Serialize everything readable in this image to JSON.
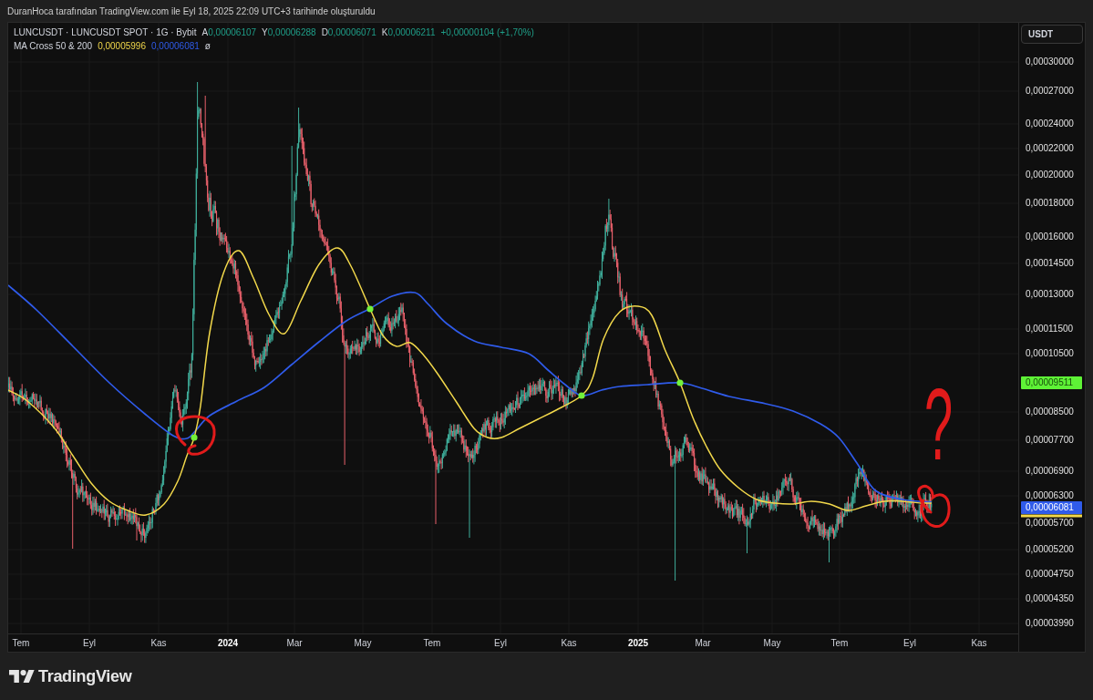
{
  "header": {
    "title": "DuranHoca tarafından TradingView.com ile Eyl 18, 2025 22:09 UTC+3 tarihinde oluşturuldu"
  },
  "legend": {
    "symbol": "LUNCUSDT · LUNCUSDT SPOT · 1G · Bybit",
    "ohlc": [
      {
        "letter": "A",
        "value": "0,00006107"
      },
      {
        "letter": "Y",
        "value": "0,00006288"
      },
      {
        "letter": "D",
        "value": "0,00006071"
      },
      {
        "letter": "K",
        "value": "0,00006211"
      }
    ],
    "change": "+0,00000104 (+1,70%)",
    "indicator": {
      "name": "MA Cross 50 & 200",
      "values": [
        {
          "text": "0,00005996",
          "color": "#f2d84b"
        },
        {
          "text": "0,00006081",
          "color": "#2f5bea"
        }
      ],
      "symbol": "ø"
    }
  },
  "price_axis": {
    "currency": "USDT",
    "labels": [
      "0,00030000",
      "0,00027000",
      "0,00024000",
      "0,00022000",
      "0,00020000",
      "0,00018000",
      "0,00016000",
      "0,00014500",
      "0,00013000",
      "0,00011500",
      "0,00010500",
      "0,00008500",
      "0,00007700",
      "0,00006900",
      "0,00006300",
      "0,00005700",
      "0,00005200",
      "0,00004750",
      "0,00004350",
      "0,00003990"
    ],
    "markers": [
      {
        "kind": "label",
        "label": "0,00009511",
        "color": "#5ef236"
      },
      {
        "kind": "label",
        "label": "0,00006081",
        "color": "#2f5bea"
      },
      {
        "kind": "edge",
        "color": "#f2d84b"
      }
    ]
  },
  "time_axis": {
    "labels": [
      {
        "text": "Tem",
        "kind": "month"
      },
      {
        "text": "Eyl",
        "kind": "month"
      },
      {
        "text": "Kas",
        "kind": "month"
      },
      {
        "text": "2024",
        "kind": "year"
      },
      {
        "text": "Mar",
        "kind": "month"
      },
      {
        "text": "May",
        "kind": "month"
      },
      {
        "text": "Tem",
        "kind": "month"
      },
      {
        "text": "Eyl",
        "kind": "month"
      },
      {
        "text": "Kas",
        "kind": "month"
      },
      {
        "text": "2025",
        "kind": "year"
      },
      {
        "text": "Mar",
        "kind": "month"
      },
      {
        "text": "May",
        "kind": "month"
      },
      {
        "text": "Tem",
        "kind": "month"
      },
      {
        "text": "Eyl",
        "kind": "month"
      },
      {
        "text": "Kas",
        "kind": "month"
      }
    ]
  },
  "annotations": {
    "question": "?"
  },
  "footer": {
    "brand": "TradingView"
  }
}
